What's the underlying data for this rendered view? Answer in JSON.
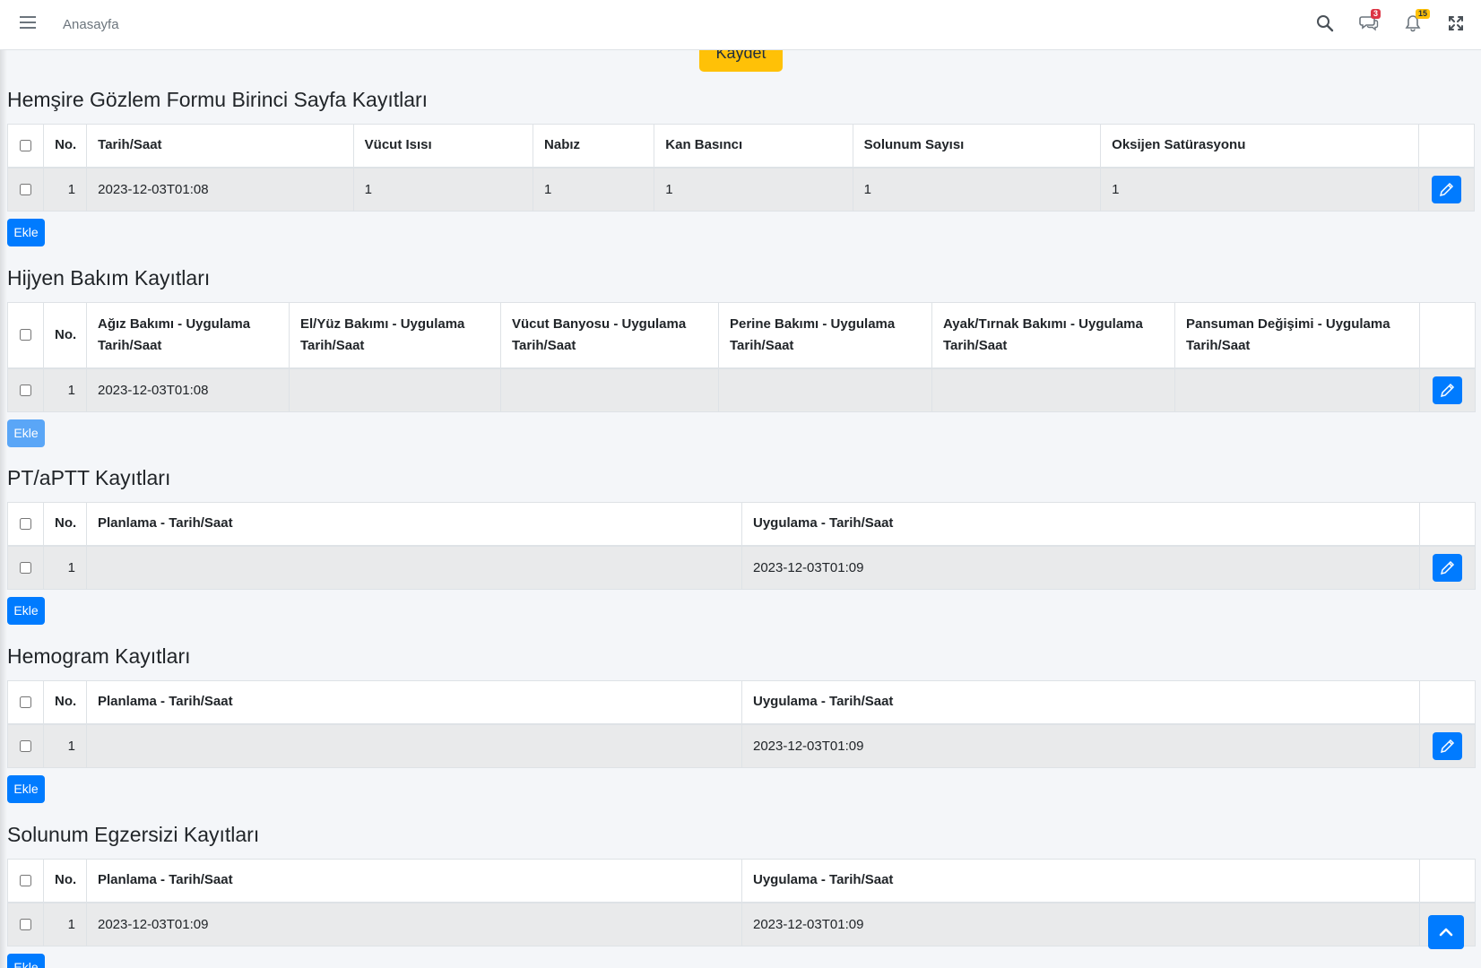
{
  "navbar": {
    "home_label": "Anasayfa",
    "messages_badge": "3",
    "notifications_badge": "15"
  },
  "save_label": "Kaydet",
  "add_label": "Ekle",
  "no_header": "No.",
  "sections": [
    {
      "title": "Hemşire Gözlem Formu Birinci Sayfa Kayıtları",
      "columns": [
        "Tarih/Saat",
        "Vücut Isısı",
        "Nabız",
        "Kan Basıncı",
        "Solunum Sayısı",
        "Oksijen Satürasyonu"
      ],
      "rows": [
        [
          "1",
          "2023-12-03T01:08",
          "1",
          "1",
          "1",
          "1",
          "1"
        ]
      ]
    },
    {
      "title": "Hijyen Bakım Kayıtları",
      "columns": [
        "Ağız Bakımı - Uygulama Tarih/Saat",
        "El/Yüz Bakımı - Uygulama Tarih/Saat",
        "Vücut Banyosu - Uygulama Tarih/Saat",
        "Perine Bakımı - Uygulama Tarih/Saat",
        "Ayak/Tırnak Bakımı - Uygulama Tarih/Saat",
        "Pansuman Değişimi - Uygulama Tarih/Saat"
      ],
      "rows": [
        [
          "1",
          "2023-12-03T01:08",
          "",
          "",
          "",
          "",
          ""
        ]
      ]
    },
    {
      "title": "PT/aPTT Kayıtları",
      "columns": [
        "Planlama - Tarih/Saat",
        "Uygulama - Tarih/Saat"
      ],
      "rows": [
        [
          "1",
          "",
          "2023-12-03T01:09"
        ]
      ]
    },
    {
      "title": "Hemogram Kayıtları",
      "columns": [
        "Planlama - Tarih/Saat",
        "Uygulama - Tarih/Saat"
      ],
      "rows": [
        [
          "1",
          "",
          "2023-12-03T01:09"
        ]
      ]
    },
    {
      "title": "Solunum Egzersizi Kayıtları",
      "columns": [
        "Planlama - Tarih/Saat",
        "Uygulama - Tarih/Saat"
      ],
      "rows": [
        [
          "1",
          "2023-12-03T01:09",
          "2023-12-03T01:09"
        ]
      ]
    }
  ]
}
